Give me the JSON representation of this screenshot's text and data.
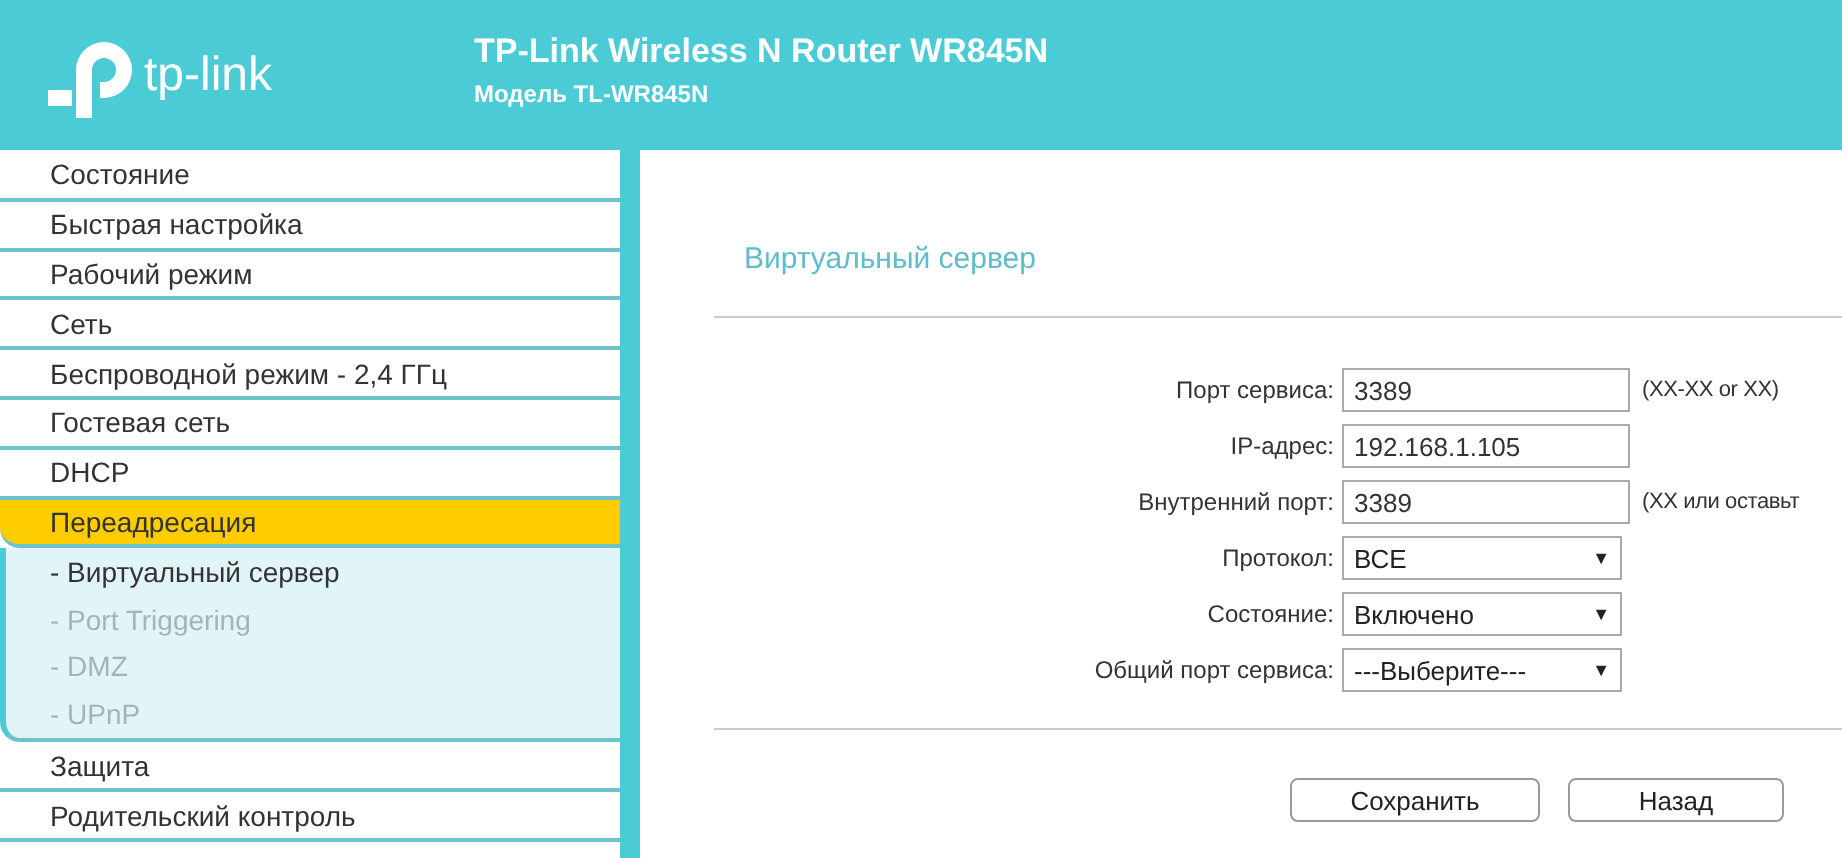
{
  "header": {
    "title": "TP-Link Wireless N Router WR845N",
    "subtitle": "Модель TL-WR845N",
    "logo_text": "tp-link"
  },
  "sidebar": {
    "items": [
      {
        "label": "Состояние",
        "selected": false
      },
      {
        "label": "Быстрая настройка",
        "selected": false
      },
      {
        "label": "Рабочий режим",
        "selected": false
      },
      {
        "label": "Сеть",
        "selected": false
      },
      {
        "label": "Беспроводной режим - 2,4 ГГц",
        "selected": false
      },
      {
        "label": "Гостевая сеть",
        "selected": false
      },
      {
        "label": "DHCP",
        "selected": false
      },
      {
        "label": "Переадресация",
        "selected": true,
        "children": [
          {
            "label": "- Виртуальный сервер",
            "selected": true
          },
          {
            "label": "- Port Triggering",
            "selected": false
          },
          {
            "label": "- DMZ",
            "selected": false
          },
          {
            "label": "- UPnP",
            "selected": false
          }
        ]
      },
      {
        "label": "Защита",
        "selected": false
      },
      {
        "label": "Родительский контроль",
        "selected": false
      }
    ]
  },
  "content": {
    "title": "Виртуальный сервер",
    "fields": [
      {
        "label": "Порт сервиса:",
        "kind": "text",
        "value": "3389",
        "hint": "(XX-XX or XX)"
      },
      {
        "label": "IP-адрес:",
        "kind": "text",
        "value": "192.168.1.105"
      },
      {
        "label": "Внутренний порт:",
        "kind": "text",
        "value": "3389",
        "hint": "(XX или оставьт"
      },
      {
        "label": "Протокол:",
        "kind": "select",
        "value": "ВСЕ",
        "arrow": "▼"
      },
      {
        "label": "Состояние:",
        "kind": "select",
        "value": "Включено",
        "arrow": "▼"
      },
      {
        "label": "Общий порт сервиса:",
        "kind": "select",
        "value": "---Выберите---",
        "arrow": "▼"
      }
    ],
    "buttons": [
      "Сохранить",
      "Назад"
    ]
  }
}
